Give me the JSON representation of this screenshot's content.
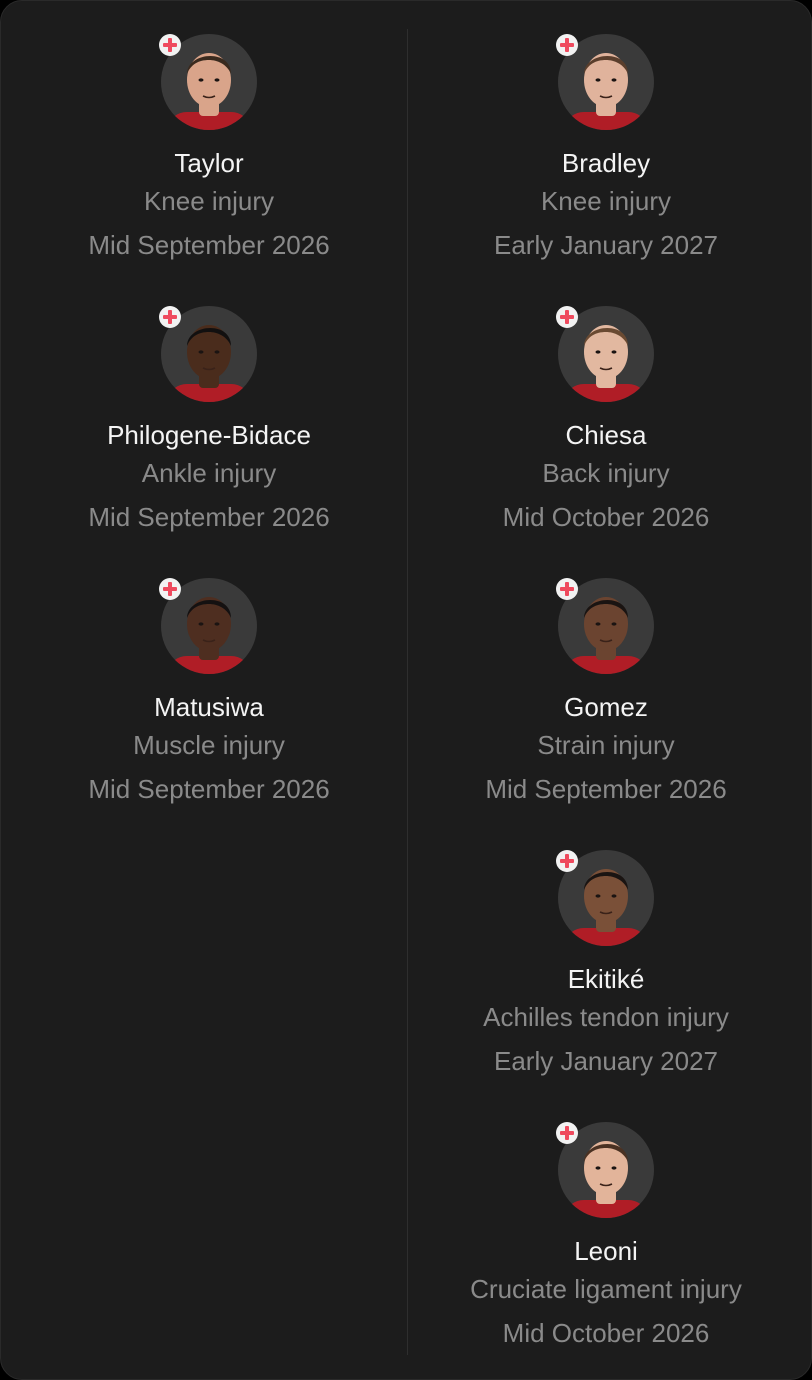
{
  "injuries": {
    "left": [
      {
        "name": "Taylor",
        "injury": "Knee injury",
        "return": "Mid September 2026",
        "skin": "#d9a48a",
        "hair": "#3a2a1e",
        "shirt": "#b01d26"
      },
      {
        "name": "Philogene-Bidace",
        "injury": "Ankle injury",
        "return": "Mid September 2026",
        "skin": "#4a2c1c",
        "hair": "#121010",
        "shirt": "#b01d26"
      },
      {
        "name": "Matusiwa",
        "injury": "Muscle injury",
        "return": "Mid September 2026",
        "skin": "#4e2e20",
        "hair": "#141111",
        "shirt": "#b01d26"
      }
    ],
    "right": [
      {
        "name": "Bradley",
        "injury": "Knee injury",
        "return": "Early January 2027",
        "skin": "#e0b39c",
        "hair": "#5a3e2c",
        "shirt": "#b01d26"
      },
      {
        "name": "Chiesa",
        "injury": "Back injury",
        "return": "Mid October 2026",
        "skin": "#e2b8a0",
        "hair": "#6a4a32",
        "shirt": "#b01d26"
      },
      {
        "name": "Gomez",
        "injury": "Strain injury",
        "return": "Mid September 2026",
        "skin": "#6b4430",
        "hair": "#1a1412",
        "shirt": "#b01d26"
      },
      {
        "name": "Ekitiké",
        "injury": "Achilles tendon injury",
        "return": "Early January 2027",
        "skin": "#7a5038",
        "hair": "#1a1412",
        "shirt": "#b01d26"
      },
      {
        "name": "Leoni",
        "injury": "Cruciate ligament injury",
        "return": "Mid October 2026",
        "skin": "#e2b49a",
        "hair": "#4a3122",
        "shirt": "#b01d26"
      }
    ]
  },
  "icons": {
    "badge": "injury-cross-icon",
    "badge_color": "#ef4a5e"
  }
}
